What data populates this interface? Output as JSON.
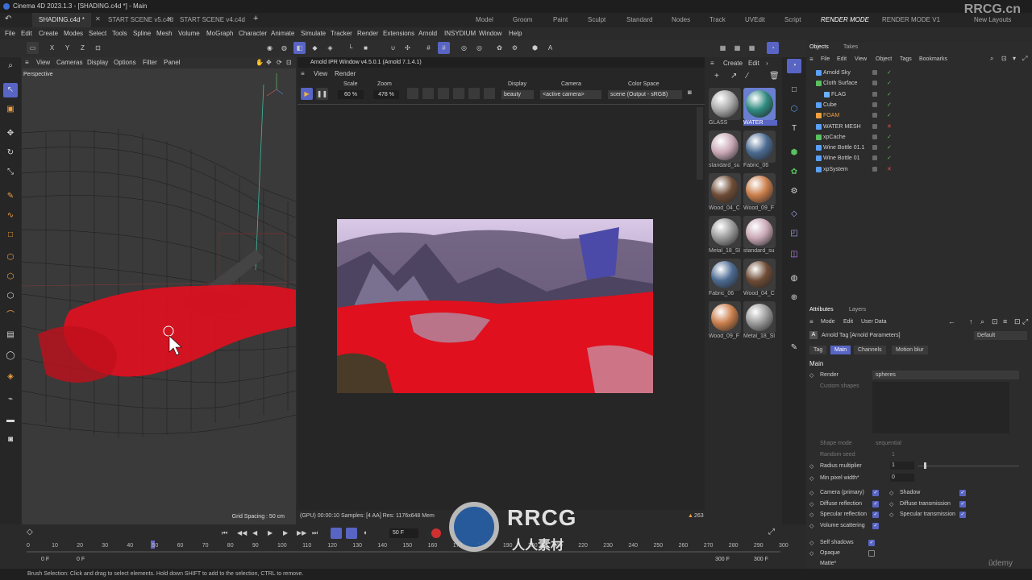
{
  "app": {
    "title": "Cinema 4D 2023.1.3 - [SHADING.c4d *] - Main"
  },
  "doc_tabs": [
    "SHADING.c4d *",
    "START SCENE v5.c4d",
    "START SCENE v4.c4d"
  ],
  "layout_tabs": [
    "Model",
    "Groom",
    "Paint",
    "Sculpt",
    "Standard",
    "Nodes",
    "Track",
    "UVEdit",
    "Script",
    "RENDER MODE",
    "RENDER MODE V1"
  ],
  "new_layouts": "New Layouts",
  "watermark_top": "RRCG.cn",
  "menus": [
    "File",
    "Edit",
    "Create",
    "Modes",
    "Select",
    "Tools",
    "Spline",
    "Mesh",
    "Volume",
    "MoGraph",
    "Character",
    "Animate",
    "Simulate",
    "Tracker",
    "Render",
    "Extensions",
    "Arnold",
    "INSYDIUM",
    "Window",
    "Help"
  ],
  "toolbar": {
    "axis_x": "X",
    "axis_y": "Y",
    "axis_z": "Z"
  },
  "viewport": {
    "menus": [
      "View",
      "Cameras",
      "Display",
      "Options",
      "Filter",
      "Panel"
    ],
    "camera_label": "Perspective",
    "grid_spacing": "Grid Spacing : 50 cm"
  },
  "ipr": {
    "title": "Arnold IPR Window v4.5.0.1 (Arnold 7.1.4.1)",
    "menus": [
      "View",
      "Render"
    ],
    "scale_label": "Scale",
    "scale_value": "60 %",
    "zoom_label": "Zoom",
    "zoom_value": "478 %",
    "display_label": "Display",
    "display_value": "beauty",
    "camera_label": "Camera",
    "camera_value": "<active camera>",
    "colorspace_label": "Color Space",
    "colorspace_value": "scene (Output - sRGB)",
    "status": "(GPU) 00:00:10  Samples: [4 AA]  Res: 1176x648  Mem",
    "status_right": "263"
  },
  "materials": {
    "menus": [
      "Create",
      "Edit"
    ],
    "items": [
      {
        "label": "GLASS",
        "color": "#a9a9a9"
      },
      {
        "label": "WATER",
        "color": "#2f8a80"
      },
      {
        "label": "standard_su",
        "color": "#c9a8b5"
      },
      {
        "label": "Fabric_06",
        "color": "#4b6a91"
      },
      {
        "label": "Wood_04_C",
        "color": "#6e4b35"
      },
      {
        "label": "Wood_09_F",
        "color": "#c97d4a"
      },
      {
        "label": "Metal_18_Sl",
        "color": "#9a9a9a"
      },
      {
        "label": "standard_su",
        "color": "#c9a8b5"
      },
      {
        "label": "Fabric_06",
        "color": "#4b6a91"
      },
      {
        "label": "Wood_04_C",
        "color": "#6e4b35"
      },
      {
        "label": "Wood_09_F",
        "color": "#c97d4a"
      },
      {
        "label": "Metal_18_Sl",
        "color": "#9a9a9a"
      }
    ]
  },
  "objects_panel": {
    "tabs": [
      "Objects",
      "Takes"
    ],
    "menus": [
      "File",
      "Edit",
      "View",
      "Object",
      "Tags",
      "Bookmarks"
    ],
    "rows": [
      {
        "name": "Arnold Sky",
        "indent": 0
      },
      {
        "name": "Cloth Surface",
        "indent": 0
      },
      {
        "name": "FLAG",
        "indent": 1
      },
      {
        "name": "Cube",
        "indent": 0
      },
      {
        "name": "FOAM",
        "indent": 0
      },
      {
        "name": "WATER MESH",
        "indent": 0
      },
      {
        "name": "xpCache",
        "indent": 0
      },
      {
        "name": "Wine Bottle 01.1",
        "indent": 0
      },
      {
        "name": "Wine Bottle 01",
        "indent": 0
      },
      {
        "name": "xpSystem",
        "indent": 0
      }
    ]
  },
  "attributes": {
    "tabs": [
      "Attributes",
      "Layers"
    ],
    "menus": [
      "Mode",
      "Edit",
      "User Data"
    ],
    "title": "Arnold Tag [Arnold Parameters]",
    "preset": "Default",
    "subtabs": [
      "Tag",
      "Main",
      "Channels",
      "Motion blur"
    ],
    "section": "Main",
    "render_label": "Render",
    "render_value": "spheres",
    "custom_shapes": "Custom shapes",
    "shape_mode_label": "Shape mode",
    "shape_mode_value": "sequential",
    "random_seed_label": "Random seed",
    "random_seed_value": "1",
    "radius_label": "Radius multiplier",
    "radius_value": "1",
    "min_pixel_label": "Min pixel width*",
    "min_pixel_value": "0",
    "checks_left": [
      "Camera (primary)",
      "Diffuse reflection",
      "Specular reflection",
      "Volume scattering"
    ],
    "checks_right": [
      "Shadow",
      "Diffuse transmission",
      "Specular transmission"
    ],
    "self_shadows": "Self shadows",
    "opaque": "Opaque",
    "matte": "Matte*"
  },
  "timeline": {
    "ticks": [
      "0",
      "10",
      "20",
      "30",
      "40",
      "50",
      "60",
      "70",
      "80",
      "90",
      "100",
      "110",
      "120",
      "130",
      "140",
      "150",
      "160",
      "170",
      "180",
      "190",
      "200",
      "210",
      "220",
      "230",
      "240",
      "250",
      "260",
      "270",
      "280",
      "290",
      "300"
    ],
    "current_frame": "50 F",
    "start": "0 F",
    "start2": "0 F",
    "end": "300 F",
    "end2": "300 F"
  },
  "watermark": {
    "main": "RRCG",
    "sub": "人人素材"
  },
  "udemy": "ûdemy",
  "status": "Brush Selection: Click and drag to select elements. Hold down SHIFT to add to the selection, CTRL to remove."
}
